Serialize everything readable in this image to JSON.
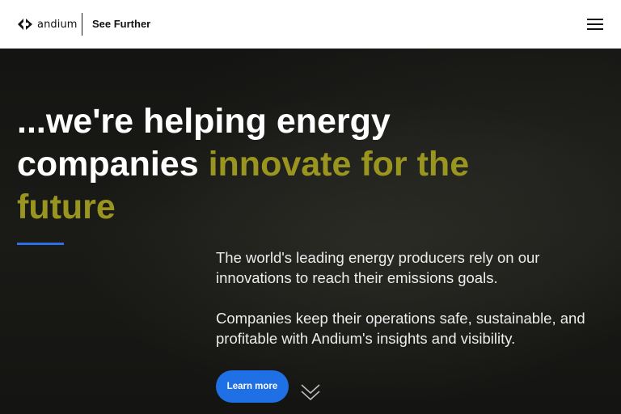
{
  "header": {
    "brand": "andium",
    "tagline": "See Further",
    "menu_icon": "hamburger-menu-icon"
  },
  "hero": {
    "headline_part1": "...we're helping energy companies ",
    "headline_accent": "innovate for the future",
    "paragraph1": "The world's leading energy producers rely on our innovations to reach their emissions goals.",
    "paragraph2": "Companies keep their operations safe, sustainable, and profitable with Andium's insights and visibility.",
    "cta_label": "Learn more",
    "scroll_icon": "double-chevron-down-icon"
  },
  "colors": {
    "accent_olive": "#9a951f",
    "brand_blue": "#1f6fe5",
    "rule_blue": "#2e6ee6",
    "background": "#141412"
  }
}
